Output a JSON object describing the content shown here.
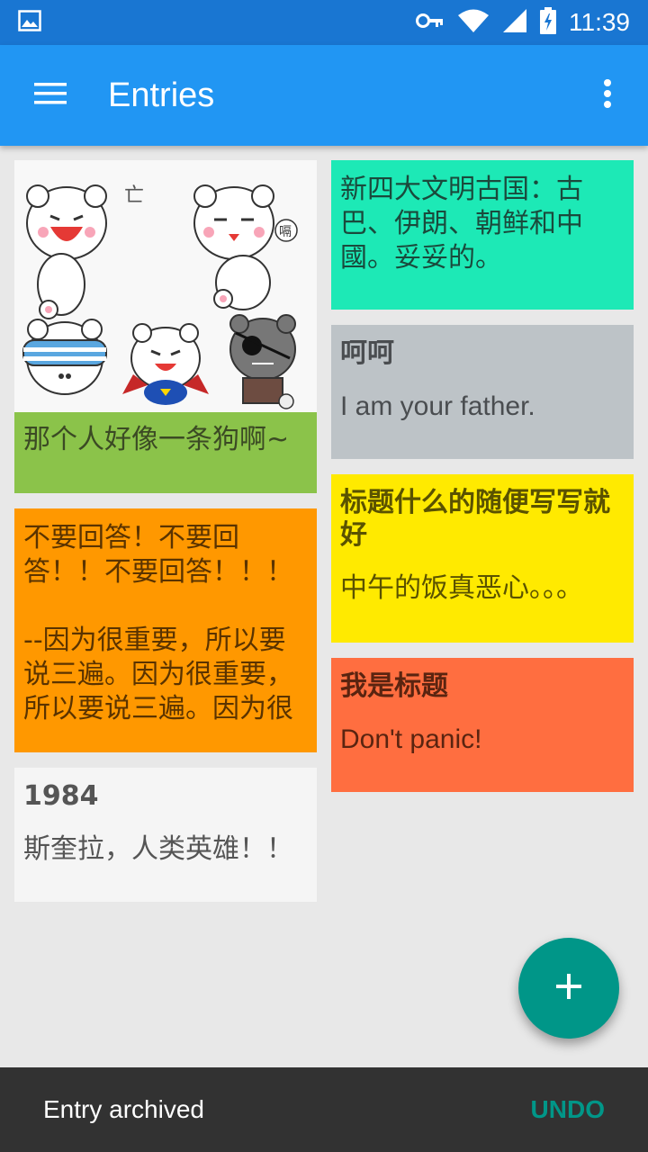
{
  "status_bar": {
    "time": "11:39",
    "icons": [
      "image-icon",
      "key-icon",
      "wifi-icon",
      "signal-icon",
      "battery-charging-icon"
    ]
  },
  "app_bar": {
    "title": "Entries",
    "menu_icon": "hamburger-menu-icon",
    "overflow_icon": "more-vert-icon"
  },
  "colors": {
    "status_bar": "#1976d2",
    "app_bar": "#2196f3",
    "background": "#e8e8e8",
    "fab": "#009688",
    "snackbar": "#323232",
    "snackbar_action": "#009688"
  },
  "entries": [
    {
      "id": "bears",
      "has_image": true,
      "image_desc": "bear-stickers-icon",
      "title": "",
      "body": "那个人好像一条狗啊~",
      "color": "#8bc34a",
      "text_color": "#3b4a24"
    },
    {
      "id": "teal",
      "title": "",
      "body": "新四大文明古国：古巴、伊朗、朝鲜和中國。妥妥的。",
      "color": "#1de9b6",
      "text_color": "#1a4a3c"
    },
    {
      "id": "haha",
      "title": "呵呵",
      "body": "I am your father.",
      "color": "#bdc3c7",
      "text_color": "#4a4d50"
    },
    {
      "id": "orange",
      "title": "",
      "body": "不要回答！不要回答！！不要回答！！！\n\n--因为很重要，所以要说三遍。因为很重要，所以要说三遍。因为很",
      "color": "#ff9800",
      "text_color": "#5a3300"
    },
    {
      "id": "yellow",
      "title": "标题什么的随便写写就好",
      "body": "中午的饭真恶心。。。",
      "color": "#ffea00",
      "text_color": "#5a5200"
    },
    {
      "id": "red",
      "title": "我是标题",
      "body": "Don't panic!",
      "color": "#ff6e40",
      "text_color": "#5a2410"
    },
    {
      "id": "1984",
      "title": "1984",
      "body": "斯奎拉，人类英雄！！",
      "color": "#f5f5f5",
      "text_color": "#555555"
    }
  ],
  "fab": {
    "icon": "plus-icon"
  },
  "snackbar": {
    "message": "Entry archived",
    "action": "UNDO"
  }
}
